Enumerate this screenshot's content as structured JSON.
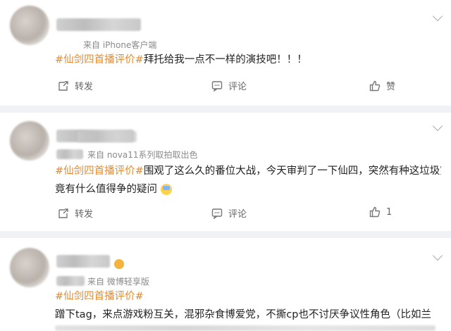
{
  "posts": [
    {
      "source": "来自 iPhone客户端",
      "tag": "#仙剑四首播评价#",
      "text": "拜托给我一点不一样的演技吧！！！",
      "text2": "",
      "actions": {
        "repost": "转发",
        "comment": "评论",
        "like": "赞"
      }
    },
    {
      "source": "来自 nova11系列取拍取出色",
      "tag": "#仙剑四首播评价#",
      "text": "围观了这么久的番位大战，今天审判了一下仙四，突然有种这垃圾究",
      "text2": "竟有什么值得争的疑问",
      "actions": {
        "repost": "转发",
        "comment": "评论",
        "like": "1"
      }
    },
    {
      "source": "来自 微博轻享版",
      "tag": "#仙剑四首播评价#",
      "text": "蹭下tag，来点游戏粉互关，混邪杂食博爱党，不撕cp也不讨厌争议性角色（比如兰",
      "text2": ""
    }
  ],
  "icons": {
    "more": "chevron-down-icon",
    "repost": "repost-icon",
    "comment": "comment-icon",
    "like": "like-icon"
  },
  "colors": {
    "tag": "#e78a2c",
    "separator": "#f1f2f5"
  }
}
